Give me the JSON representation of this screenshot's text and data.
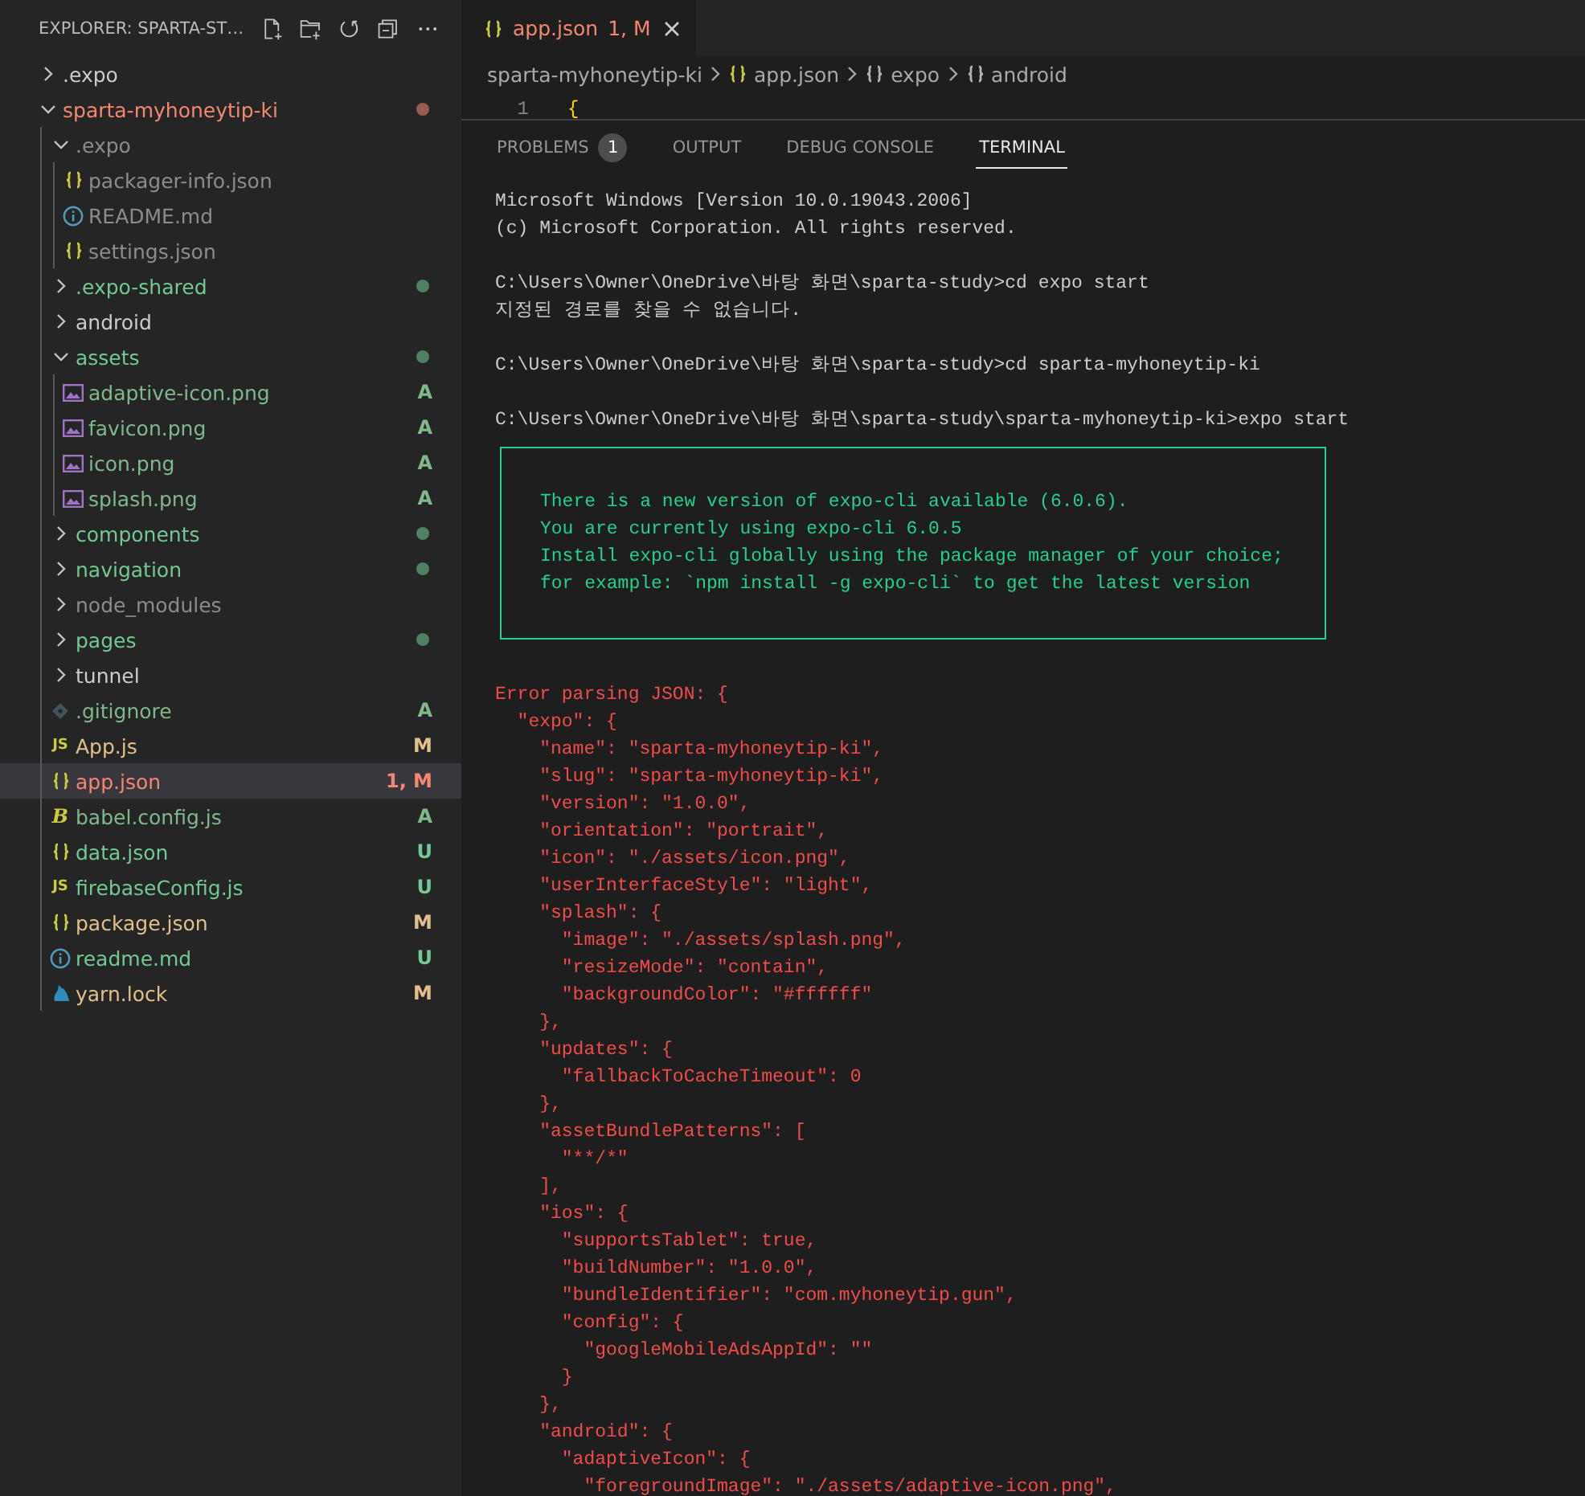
{
  "explorer": {
    "title": "EXPLORER: SPARTA-ST…",
    "tree": [
      {
        "kind": "folder",
        "label": ".expo",
        "expanded": false,
        "selected": false,
        "color": "#cccccc"
      },
      {
        "kind": "folder",
        "label": "sparta-myhoneytip-ki",
        "expanded": true,
        "selected": false,
        "color": "#f48771",
        "dot": true,
        "children": [
          {
            "kind": "folder",
            "label": ".expo",
            "expanded": true,
            "selected": false,
            "color": "#8c8c8c",
            "children": [
              {
                "kind": "json",
                "label": "packager-info.json",
                "selected": false,
                "color": "#8c8c8c"
              },
              {
                "kind": "info",
                "label": "README.md",
                "selected": false,
                "color": "#8c8c8c"
              },
              {
                "kind": "json",
                "label": "settings.json",
                "selected": false,
                "color": "#8c8c8c"
              }
            ]
          },
          {
            "kind": "folder",
            "label": ".expo-shared",
            "expanded": false,
            "selected": false,
            "color": "#73c991",
            "dot": true
          },
          {
            "kind": "folder",
            "label": "android",
            "expanded": false,
            "selected": false,
            "color": "#cccccc"
          },
          {
            "kind": "folder",
            "label": "assets",
            "expanded": true,
            "selected": false,
            "color": "#73c991",
            "dot": true,
            "children": [
              {
                "kind": "image",
                "label": "adaptive-icon.png",
                "selected": false,
                "color": "#81b88b",
                "badge": "A"
              },
              {
                "kind": "image",
                "label": "favicon.png",
                "selected": false,
                "color": "#81b88b",
                "badge": "A"
              },
              {
                "kind": "image",
                "label": "icon.png",
                "selected": false,
                "color": "#81b88b",
                "badge": "A"
              },
              {
                "kind": "image",
                "label": "splash.png",
                "selected": false,
                "color": "#81b88b",
                "badge": "A"
              }
            ]
          },
          {
            "kind": "folder",
            "label": "components",
            "expanded": false,
            "selected": false,
            "color": "#73c991",
            "dot": true
          },
          {
            "kind": "folder",
            "label": "navigation",
            "expanded": false,
            "selected": false,
            "color": "#73c991",
            "dot": true
          },
          {
            "kind": "folder",
            "label": "node_modules",
            "expanded": false,
            "selected": false,
            "color": "#8c8c8c"
          },
          {
            "kind": "folder",
            "label": "pages",
            "expanded": false,
            "selected": false,
            "color": "#73c991",
            "dot": true
          },
          {
            "kind": "folder",
            "label": "tunnel",
            "expanded": false,
            "selected": false,
            "color": "#cccccc"
          },
          {
            "kind": "git",
            "label": ".gitignore",
            "selected": false,
            "color": "#81b88b",
            "badge": "A"
          },
          {
            "kind": "script",
            "glyph": "JS",
            "label": "App.js",
            "selected": false,
            "color": "#e2c08d",
            "badge": "M"
          },
          {
            "kind": "json",
            "label": "app.json",
            "selected": true,
            "color": "#f48771",
            "badge": "1, M"
          },
          {
            "kind": "babel",
            "glyph": "B",
            "label": "babel.config.js",
            "selected": false,
            "color": "#81b88b",
            "badge": "A"
          },
          {
            "kind": "json",
            "label": "data.json",
            "selected": false,
            "color": "#73c991",
            "badge": "U"
          },
          {
            "kind": "script",
            "glyph": "JS",
            "label": "firebaseConfig.js",
            "selected": false,
            "color": "#73c991",
            "badge": "U"
          },
          {
            "kind": "json",
            "label": "package.json",
            "selected": false,
            "color": "#e2c08d",
            "badge": "M"
          },
          {
            "kind": "info",
            "label": "readme.md",
            "selected": false,
            "color": "#73c991",
            "badge": "U"
          },
          {
            "kind": "yarn",
            "label": "yarn.lock",
            "selected": false,
            "color": "#e2c08d",
            "badge": "M"
          }
        ]
      }
    ]
  },
  "editor": {
    "tab": {
      "label": "app.json",
      "badge": "1, M",
      "color": "#f48771",
      "selected": true
    },
    "breadcrumb": [
      {
        "kind": "folder",
        "label": "sparta-myhoneytip-ki"
      },
      {
        "kind": "file",
        "label": "app.json"
      },
      {
        "kind": "object",
        "label": "expo"
      },
      {
        "kind": "object",
        "label": "android"
      }
    ],
    "line": {
      "number": "1",
      "text": "{"
    }
  },
  "panel": {
    "tabs": [
      {
        "label": "PROBLEMS",
        "badge": "1",
        "selected": false
      },
      {
        "label": "OUTPUT",
        "selected": false
      },
      {
        "label": "DEBUG CONSOLE",
        "selected": false
      },
      {
        "label": "TERMINAL",
        "selected": true
      }
    ],
    "terminal": [
      {
        "kind": "output",
        "text": "Microsoft Windows [Version 10.0.19043.2006]"
      },
      {
        "kind": "output",
        "text": "(c) Microsoft Corporation. All rights reserved."
      },
      {
        "kind": "blank"
      },
      {
        "kind": "output",
        "text": "C:\\Users\\Owner\\OneDrive\\바탕 화면\\sparta-study>cd expo start"
      },
      {
        "kind": "output",
        "text": "지정된 경로를 찾을 수 없습니다."
      },
      {
        "kind": "blank"
      },
      {
        "kind": "output",
        "text": "C:\\Users\\Owner\\OneDrive\\바탕 화면\\sparta-study>cd sparta-myhoneytip-ki"
      },
      {
        "kind": "blank"
      },
      {
        "kind": "output",
        "text": "C:\\Users\\Owner\\OneDrive\\바탕 화면\\sparta-study\\sparta-myhoneytip-ki>expo start"
      },
      {
        "kind": "notice",
        "lines": [
          "There is a new version of expo-cli available (6.0.6).",
          "You are currently using expo-cli 6.0.5",
          "Install expo-cli globally using the package manager of your choice;",
          "for example: `npm install -g expo-cli` to get the latest version"
        ]
      },
      {
        "kind": "error",
        "text": "Error parsing JSON: {"
      },
      {
        "kind": "error",
        "text": "  \"expo\": {"
      },
      {
        "kind": "error",
        "text": "    \"name\": \"sparta-myhoneytip-ki\","
      },
      {
        "kind": "error",
        "text": "    \"slug\": \"sparta-myhoneytip-ki\","
      },
      {
        "kind": "error",
        "text": "    \"version\": \"1.0.0\","
      },
      {
        "kind": "error",
        "text": "    \"orientation\": \"portrait\","
      },
      {
        "kind": "error",
        "text": "    \"icon\": \"./assets/icon.png\","
      },
      {
        "kind": "error",
        "text": "    \"userInterfaceStyle\": \"light\","
      },
      {
        "kind": "error",
        "text": "    \"splash\": {"
      },
      {
        "kind": "error",
        "text": "      \"image\": \"./assets/splash.png\","
      },
      {
        "kind": "error",
        "text": "      \"resizeMode\": \"contain\","
      },
      {
        "kind": "error",
        "text": "      \"backgroundColor\": \"#ffffff\""
      },
      {
        "kind": "error",
        "text": "    },"
      },
      {
        "kind": "error",
        "text": "    \"updates\": {"
      },
      {
        "kind": "error",
        "text": "      \"fallbackToCacheTimeout\": 0"
      },
      {
        "kind": "error",
        "text": "    },"
      },
      {
        "kind": "error",
        "text": "    \"assetBundlePatterns\": ["
      },
      {
        "kind": "error",
        "text": "      \"**/*\""
      },
      {
        "kind": "error",
        "text": "    ],"
      },
      {
        "kind": "error",
        "text": "    \"ios\": {"
      },
      {
        "kind": "error",
        "text": "      \"supportsTablet\": true,"
      },
      {
        "kind": "error",
        "text": "      \"buildNumber\": \"1.0.0\","
      },
      {
        "kind": "error",
        "text": "      \"bundleIdentifier\": \"com.myhoneytip.gun\","
      },
      {
        "kind": "error",
        "text": "      \"config\": {"
      },
      {
        "kind": "error",
        "text": "        \"googleMobileAdsAppId\": \"\""
      },
      {
        "kind": "error",
        "text": "      }"
      },
      {
        "kind": "error",
        "text": "    },"
      },
      {
        "kind": "error",
        "text": "    \"android\": {"
      },
      {
        "kind": "error",
        "text": "      \"adaptiveIcon\": {"
      },
      {
        "kind": "error",
        "text": "        \"foregroundImage\": \"./assets/adaptive-icon.png\","
      }
    ]
  }
}
